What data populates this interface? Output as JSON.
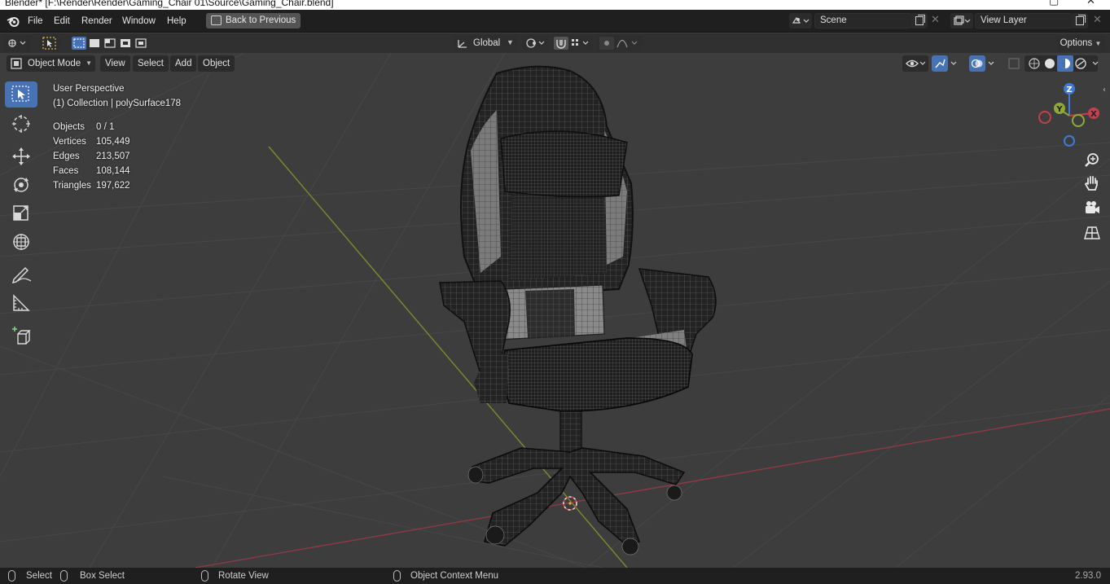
{
  "window": {
    "title": "Blender* [F:\\Render\\Render\\Gaming_Chair 01\\Source\\Gaming_Chair.blend]"
  },
  "menu": {
    "items": [
      "File",
      "Edit",
      "Render",
      "Window",
      "Help"
    ],
    "back_button": "Back to Previous",
    "scene": "Scene",
    "view_layer": "View Layer"
  },
  "header": {
    "transform_orientation": "Global",
    "options": "Options"
  },
  "viewport_header": {
    "mode": "Object Mode",
    "menus": [
      "View",
      "Select",
      "Add",
      "Object"
    ]
  },
  "overlay": {
    "perspective": "User Perspective",
    "collection": "(1) Collection | polySurface178",
    "stats": [
      {
        "label": "Objects",
        "value": "0 / 1"
      },
      {
        "label": "Vertices",
        "value": "105,449"
      },
      {
        "label": "Edges",
        "value": "213,507"
      },
      {
        "label": "Faces",
        "value": "108,144"
      },
      {
        "label": "Triangles",
        "value": "197,622"
      }
    ]
  },
  "gizmo": {
    "z": "Z",
    "y": "Y",
    "x": "X"
  },
  "statusbar": {
    "select": "Select",
    "box_select": "Box Select",
    "rotate_view": "Rotate View",
    "context_menu": "Object Context Menu",
    "version": "2.93.0"
  },
  "colors": {
    "x_axis": "#c2414c",
    "y_axis": "#8ea83a",
    "z_axis": "#3f7ad6",
    "active_tool": "#4772b3"
  },
  "tools": [
    "select-box-tool",
    "cursor-tool",
    "move-tool",
    "rotate-tool",
    "scale-tool",
    "transform-tool",
    "annotate-tool",
    "measure-tool",
    "add-cube-tool"
  ]
}
